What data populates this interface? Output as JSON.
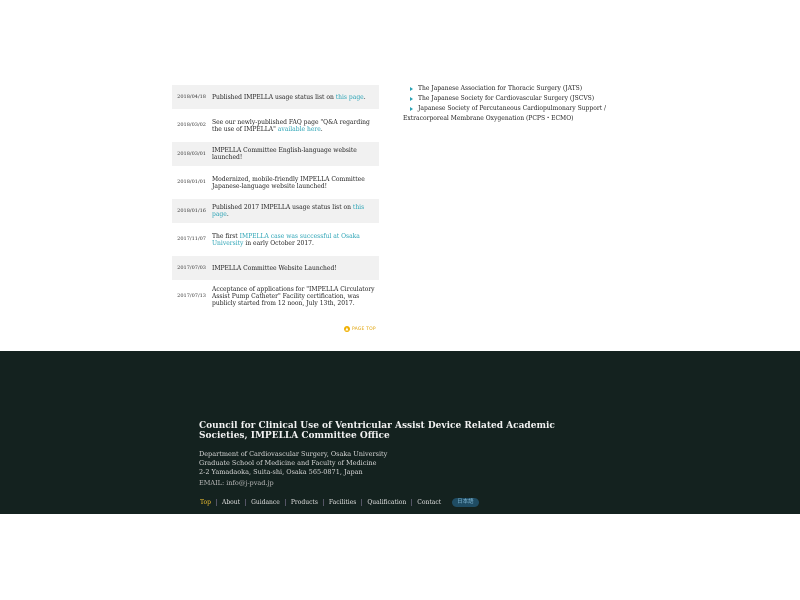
{
  "news": [
    {
      "date": "2018/04/18",
      "pre": "Published IMPELLA usage status list on ",
      "link": "this page",
      "post": ".",
      "shaded": true
    },
    {
      "date": "2018/03/02",
      "pre": "See our newly-published FAQ page \"Q&A regarding the use of IMPELLA\" ",
      "link": "available here",
      "post": ".",
      "shaded": false
    },
    {
      "date": "2018/03/01",
      "pre": "IMPELLA Committee English-language website launched!",
      "link": "",
      "post": "",
      "shaded": true
    },
    {
      "date": "2018/01/01",
      "pre": "Modernized, mobile-friendly IMPELLA Committee Japanese-language website launched!",
      "link": "",
      "post": "",
      "shaded": false
    },
    {
      "date": "2018/01/16",
      "pre": "Published 2017 IMPELLA usage status list on ",
      "link": "this page",
      "post": ".",
      "shaded": true
    },
    {
      "date": "2017/11/07",
      "pre": "The first ",
      "link": "IMPELLA case was successful at Osaka University",
      "post": " in early October 2017.",
      "shaded": false
    },
    {
      "date": "2017/07/03",
      "pre": "IMPELLA Committee Website Launched!",
      "link": "",
      "post": "",
      "shaded": true
    },
    {
      "date": "2017/07/13",
      "pre": "Acceptance of applications for \"IMPELLA Circulatory Assist Pump Catheter\" Facility certification, was publicly started from 12 noon, July 13th, 2017.",
      "link": "",
      "post": "",
      "shaded": false
    }
  ],
  "page_top_label": "PAGE TOP",
  "societies": [
    "The Japanese Association for Thoracic Surgery (JATS)",
    "The Japanese Society for Cardiovascular Surgery (JSCVS)",
    "Japanese Society of Percutaneous Cardiopulmonary Support / Extracorporeal Membrane Oxygenation (PCPS・ECMO)"
  ],
  "footer": {
    "title": "Council for Clinical Use of Ventricular Assist Device Related Academic Societies, IMPELLA Committee Office",
    "address_lines": [
      "Department of Cardiovascular Surgery, Osaka University",
      "Graduate School of Medicine and Faculty of Medicine",
      "2-2 Yamadaoka, Suita-shi, Osaka 565-0871, Japan"
    ],
    "email": "EMAIL: info@j-pvad.jp",
    "nav": [
      "Top",
      "About",
      "Guidance",
      "Products",
      "Facilities",
      "Qualification",
      "Contact"
    ],
    "lang_button": "日本語"
  },
  "colors": {
    "link": "#2aa3b5",
    "footer_bg": "#14221f",
    "nav_active": "#f0c030",
    "page_top": "#e0a000"
  }
}
